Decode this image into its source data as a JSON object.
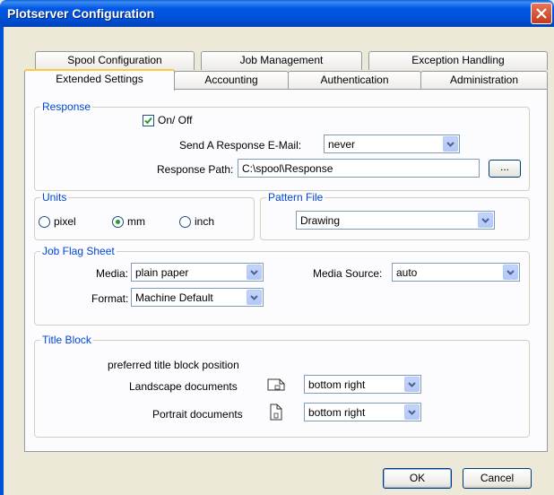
{
  "window": {
    "title": "Plotserver Configuration"
  },
  "tabs_row1": [
    "Spool Configuration",
    "Job Management",
    "Exception Handling"
  ],
  "tabs_row2": [
    "Extended Settings",
    "Accounting",
    "Authentication",
    "Administration"
  ],
  "active_tab": "Extended Settings",
  "response": {
    "group_label": "Response",
    "onoff_label": "On/ Off",
    "onoff_checked": true,
    "email_label": "Send A Response E-Mail:",
    "email_value": "never",
    "path_label": "Response Path:",
    "path_value": "C:\\spool\\Response",
    "browse_label": "..."
  },
  "units": {
    "group_label": "Units",
    "options": [
      "pixel",
      "mm",
      "inch"
    ],
    "selected": "mm"
  },
  "pattern_file": {
    "group_label": "Pattern File",
    "value": "Drawing"
  },
  "job_flag_sheet": {
    "group_label": "Job Flag Sheet",
    "media_label": "Media:",
    "media_value": "plain paper",
    "format_label": "Format:",
    "format_value": "Machine Default",
    "source_label": "Media Source:",
    "source_value": "auto"
  },
  "title_block": {
    "group_label": "Title Block",
    "heading": "preferred title block position",
    "landscape_label": "Landscape documents",
    "landscape_value": "bottom right",
    "portrait_label": "Portrait documents",
    "portrait_value": "bottom right"
  },
  "buttons": {
    "ok": "OK",
    "cancel": "Cancel"
  },
  "icons": [
    "close-icon",
    "chevron-down-icon",
    "checkmark-icon",
    "landscape-document-icon",
    "portrait-document-icon"
  ]
}
